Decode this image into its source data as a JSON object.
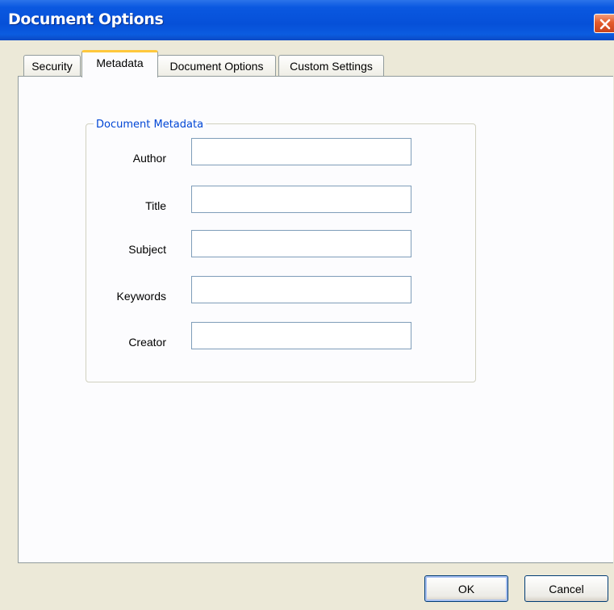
{
  "window": {
    "title": "Document Options"
  },
  "tabs": [
    {
      "label": "Security",
      "active": false
    },
    {
      "label": "Metadata",
      "active": true
    },
    {
      "label": "Document Options",
      "active": false
    },
    {
      "label": "Custom Settings",
      "active": false
    }
  ],
  "metadata": {
    "group_title": "Document Metadata",
    "fields": [
      {
        "label": "Author",
        "value": ""
      },
      {
        "label": "Title",
        "value": ""
      },
      {
        "label": "Subject",
        "value": ""
      },
      {
        "label": "Keywords",
        "value": ""
      },
      {
        "label": "Creator",
        "value": ""
      }
    ]
  },
  "buttons": {
    "ok": "OK",
    "cancel": "Cancel"
  },
  "icons": {
    "close": "close-icon"
  },
  "colors": {
    "titlebar": "#0650d8",
    "close_button": "#e45b2b",
    "active_tab_highlight": "#ffc83c",
    "group_title": "#0046d5",
    "input_border": "#7f9db9"
  }
}
